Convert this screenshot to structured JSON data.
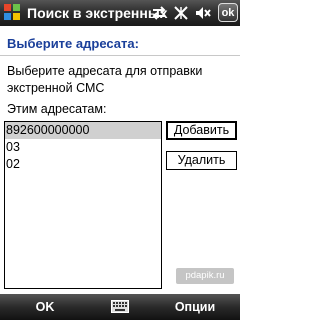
{
  "titlebar": {
    "title": "Поиск в экстренных",
    "ok_label": "ok",
    "icons": [
      "windows-logo",
      "sync-arrows-icon",
      "no-signal-icon",
      "mute-speaker-icon"
    ]
  },
  "header": "Выберите адресата:",
  "description": "Выберите адресата для отправки экстренной СМС",
  "list_label": "Этим адресатам:",
  "recipients": [
    "892600000000",
    "03",
    "02"
  ],
  "selected_index": 0,
  "buttons": {
    "add": "Добавить",
    "remove": "Удалить"
  },
  "watermark": "pdapik.ru",
  "softkeys": {
    "left": "OK",
    "right": "Опции",
    "center_icon": "keyboard-icon"
  },
  "colors": {
    "header": "#1a3f9a",
    "selection": "#d0d0d0"
  }
}
